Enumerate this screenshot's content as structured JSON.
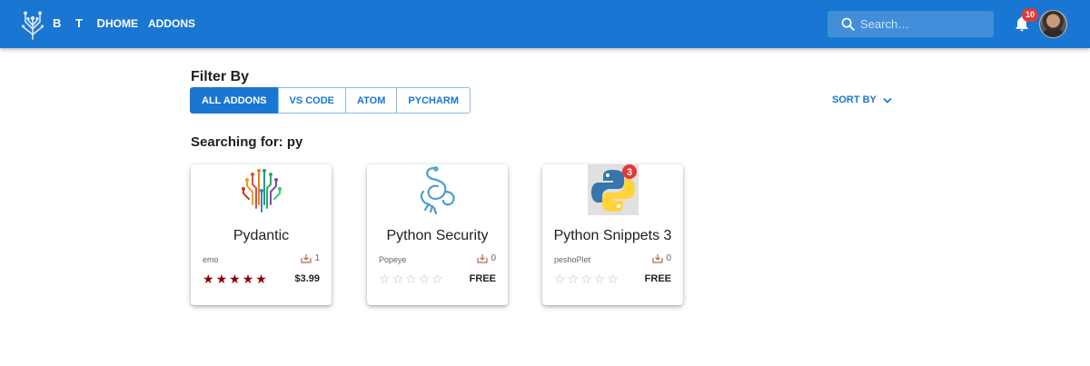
{
  "app": {
    "brand": "B T D",
    "nav": {
      "home": "HOME",
      "addons": "ADDONS"
    },
    "search": {
      "placeholder": "Search…",
      "value": ""
    },
    "notifications": {
      "count": "10"
    },
    "accent_color": "#1976d2"
  },
  "filter": {
    "title": "Filter By",
    "options": [
      {
        "label": "ALL ADDONS",
        "active": true
      },
      {
        "label": "VS CODE",
        "active": false
      },
      {
        "label": "ATOM",
        "active": false
      },
      {
        "label": "PYCHARM",
        "active": false
      }
    ],
    "sort_label": "SORT BY"
  },
  "results": {
    "label": "Searching for: py",
    "cards": [
      {
        "title": "Pydantic",
        "author": "emo",
        "downloads": "1",
        "rating": 5,
        "price": "$3.99",
        "icon": "pydantic-logo"
      },
      {
        "title": "Python Security",
        "author": "Popeye",
        "downloads": "0",
        "rating": 0,
        "price": "FREE",
        "icon": "python-security-logo"
      },
      {
        "title": "Python Snippets 3",
        "author": "peshoPlet",
        "downloads": "0",
        "rating": 0,
        "price": "FREE",
        "icon": "python-snippets-logo"
      }
    ]
  }
}
